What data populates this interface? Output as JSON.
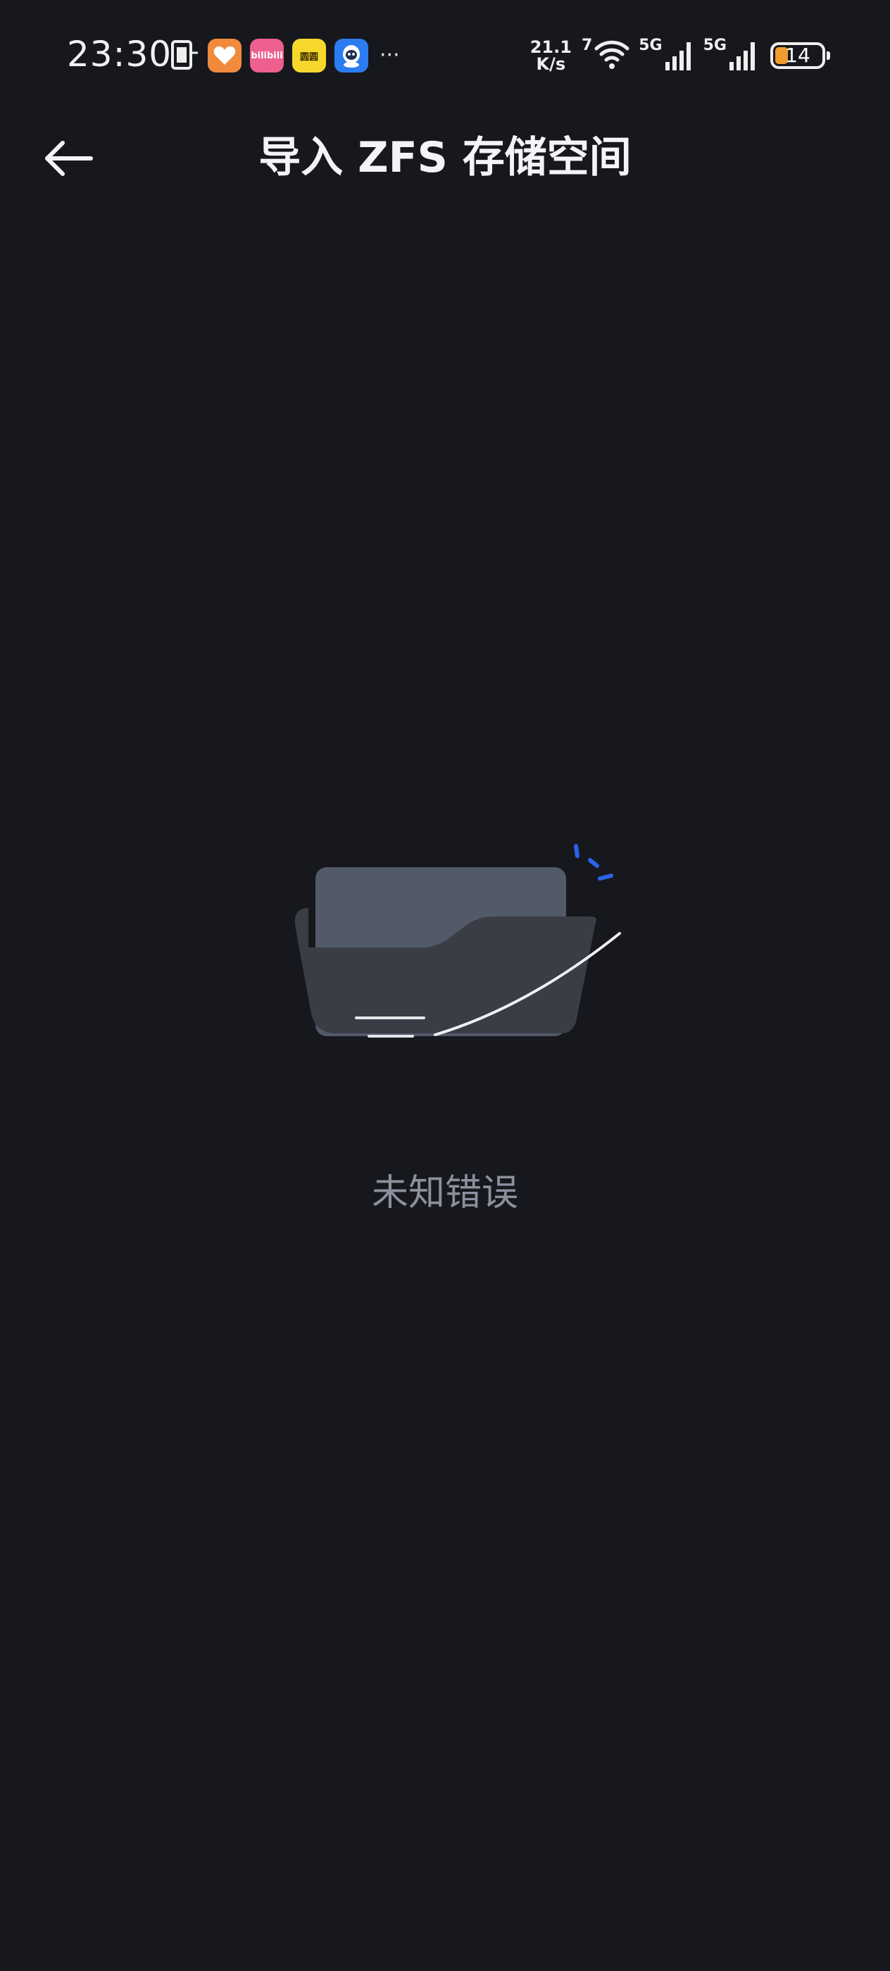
{
  "status_bar": {
    "time": "23:30",
    "notification_icons": [
      "phone-icon",
      "heart-app-icon",
      "bilibili-icon",
      "yellow-app-icon",
      "qq-icon"
    ],
    "bili_label": "bilibili",
    "yellow_app_label": "圆圆",
    "more": "···",
    "net_speed_value": "21.1",
    "net_speed_unit": "K/s",
    "wifi_label": "7",
    "signal_1_label": "5G",
    "signal_2_label": "5G",
    "battery_level": "14",
    "battery_fraction": 0.14,
    "battery_color": "#f29b2e"
  },
  "header": {
    "back_icon": "arrow-left-icon",
    "title": "导入 ZFS 存储空间"
  },
  "empty_state": {
    "illustration": "empty-folder-icon",
    "message": "未知错误",
    "accent_color": "#2b63e8"
  },
  "colors": {
    "background": "#17181d",
    "folder_back": "#525a69",
    "folder_front": "#3a3d45",
    "message_text": "#8a919e"
  }
}
